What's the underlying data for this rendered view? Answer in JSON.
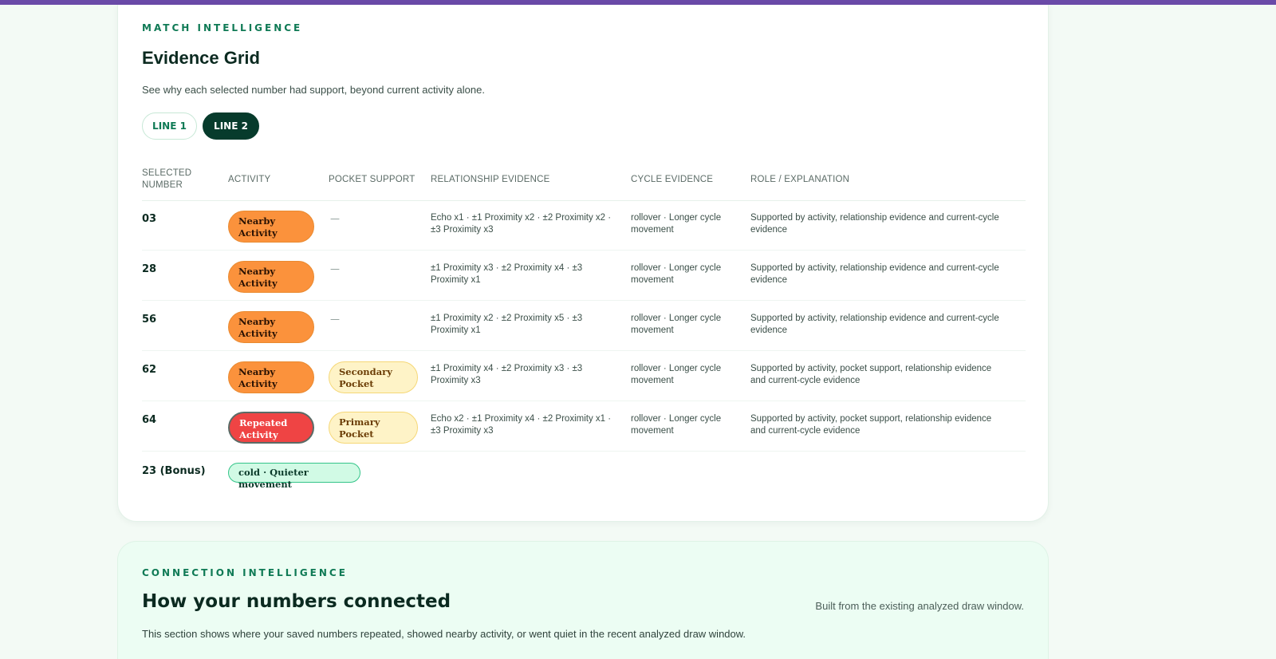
{
  "evidence": {
    "eyebrow": "MATCH INTELLIGENCE",
    "title": "Evidence Grid",
    "subtitle": "See why each selected number had support, beyond current activity alone.",
    "tabs": [
      {
        "label": "LINE 1",
        "active": false
      },
      {
        "label": "LINE 2",
        "active": true
      }
    ],
    "columns": {
      "selected_1": "SELECTED",
      "selected_2": "NUMBER",
      "activity": "ACTIVITY",
      "pocket": "POCKET SUPPORT",
      "relationship": "RELATIONSHIP EVIDENCE",
      "cycle": "CYCLE EVIDENCE",
      "role": "ROLE / EXPLANATION"
    },
    "rows": [
      {
        "number": "03",
        "activity_1": "Nearby",
        "activity_2": "Activity",
        "pocket_1": "",
        "pocket_2": "",
        "pocket_dash": "—",
        "rel_1": "Echo x1 · ±1 Proximity x2 · ±2 Proximity x2 ·",
        "rel_2": "±3 Proximity x3",
        "cycle_1": "rollover · Longer cycle",
        "cycle_2": "movement",
        "role_1": "Supported by activity, relationship evidence and current-cycle",
        "role_2": "evidence"
      },
      {
        "number": "28",
        "activity_1": "Nearby",
        "activity_2": "Activity",
        "pocket_1": "",
        "pocket_2": "",
        "pocket_dash": "—",
        "rel_1": "±1 Proximity x3 · ±2 Proximity x4 · ±3",
        "rel_2": "Proximity x1",
        "cycle_1": "rollover · Longer cycle",
        "cycle_2": "movement",
        "role_1": "Supported by activity, relationship evidence and current-cycle",
        "role_2": "evidence"
      },
      {
        "number": "56",
        "activity_1": "Nearby",
        "activity_2": "Activity",
        "pocket_1": "",
        "pocket_2": "",
        "pocket_dash": "—",
        "rel_1": "±1 Proximity x2 · ±2 Proximity x5 · ±3",
        "rel_2": "Proximity x1",
        "cycle_1": "rollover · Longer cycle",
        "cycle_2": "movement",
        "role_1": "Supported by activity, relationship evidence and current-cycle",
        "role_2": "evidence"
      },
      {
        "number": "62",
        "activity_1": "Nearby",
        "activity_2": "Activity",
        "pocket_1": "Secondary",
        "pocket_2": "Pocket",
        "pocket_dash": "",
        "rel_1": "±1 Proximity x4 · ±2 Proximity x3 · ±3",
        "rel_2": "Proximity x3",
        "cycle_1": "rollover · Longer cycle",
        "cycle_2": "movement",
        "role_1": "Supported by activity, pocket support, relationship evidence",
        "role_2": "and current-cycle evidence"
      },
      {
        "number": "64",
        "activity_1": "Repeated",
        "activity_2": "Activity",
        "pocket_1": "Primary",
        "pocket_2": "Pocket",
        "pocket_dash": "",
        "rel_1": "Echo x2 · ±1 Proximity x4 · ±2 Proximity x1 ·",
        "rel_2": "±3 Proximity x3",
        "cycle_1": "rollover · Longer cycle",
        "cycle_2": "movement",
        "role_1": "Supported by activity, pocket support, relationship evidence",
        "role_2": "and current-cycle evidence"
      }
    ],
    "bonus": {
      "number": "23 (Bonus)",
      "badge": "cold · Quieter movement"
    }
  },
  "connection": {
    "eyebrow": "CONNECTION INTELLIGENCE",
    "title": "How your numbers connected",
    "side_note": "Built from the existing analyzed draw window.",
    "subtitle": "This section shows where your saved numbers repeated, showed nearby activity, or went quiet in the recent analyzed draw window."
  },
  "colors": {
    "accent_purple": "#6a4aa8",
    "brand_green": "#0f7a55",
    "nearby_orange": "#fb923c",
    "repeated_red": "#ef4444",
    "pocket_yellow": "#fef3c7",
    "cold_mint": "#d1fae5"
  }
}
